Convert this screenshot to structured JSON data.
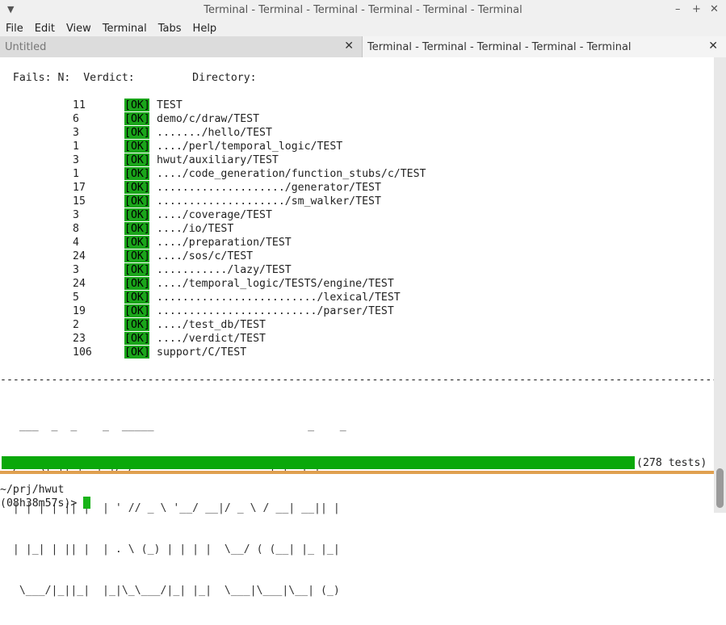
{
  "window": {
    "title": "Terminal - Terminal - Terminal - Terminal - Terminal - Terminal"
  },
  "menu": [
    "File",
    "Edit",
    "View",
    "Terminal",
    "Tabs",
    "Help"
  ],
  "tabs": [
    {
      "label": "Untitled",
      "active": false
    },
    {
      "label": "Terminal - Terminal - Terminal - Terminal - Terminal",
      "active": true
    }
  ],
  "terminal": {
    "header": "  Fails: N:  Verdict:         Directory:",
    "ok_label": "[OK]",
    "rows": [
      {
        "n": "11",
        "dir": "TEST"
      },
      {
        "n": "6",
        "dir": "demo/c/draw/TEST"
      },
      {
        "n": "3",
        "dir": "......./hello/TEST"
      },
      {
        "n": "1",
        "dir": "..../perl/temporal_logic/TEST"
      },
      {
        "n": "3",
        "dir": "hwut/auxiliary/TEST"
      },
      {
        "n": "1",
        "dir": "..../code_generation/function_stubs/c/TEST"
      },
      {
        "n": "17",
        "dir": "..................../generator/TEST"
      },
      {
        "n": "15",
        "dir": "..................../sm_walker/TEST"
      },
      {
        "n": "3",
        "dir": "..../coverage/TEST"
      },
      {
        "n": "8",
        "dir": "..../io/TEST"
      },
      {
        "n": "4",
        "dir": "..../preparation/TEST"
      },
      {
        "n": "24",
        "dir": "..../sos/c/TEST"
      },
      {
        "n": "3",
        "dir": ".........../lazy/TEST"
      },
      {
        "n": "24",
        "dir": "..../temporal_logic/TESTS/engine/TEST"
      },
      {
        "n": "5",
        "dir": "........................./lexical/TEST"
      },
      {
        "n": "19",
        "dir": "........................./parser/TEST"
      },
      {
        "n": "2",
        "dir": "..../test_db/TEST"
      },
      {
        "n": "23",
        "dir": "..../verdict/TEST"
      },
      {
        "n": "106",
        "dir": "support/C/TEST"
      }
    ],
    "separator": "-----------------------------------------------------------------------------------------------------------------------",
    "banner_lines": [
      "   ___  _  _    _  _____                        _    _ ",
      "  / _ \\| || |  | |/ /___ _ __ ___  ___ ___| |_ | |",
      "  | | | | || |  | ' // _ \\ '__/ __|/ _ \\ / __| __|| |",
      "  | |_| | || |  | . \\ (_) | | | |  \\__/ ( (__| |_ |_|",
      "   \\___/|_||_|  |_|\\_\\___/|_| |_|  \\___|\\___|\\__| (_)"
    ],
    "progress": {
      "label": "(278 tests)",
      "fraction": 1.0
    },
    "prompt_dir": "~/prj/hwut",
    "prompt": "(08h38m57s)> "
  },
  "colors": {
    "ok_bg": "#1aa51a",
    "bar": "#0aa80a",
    "cursor": "#19b319",
    "separator": "#e0a050"
  }
}
